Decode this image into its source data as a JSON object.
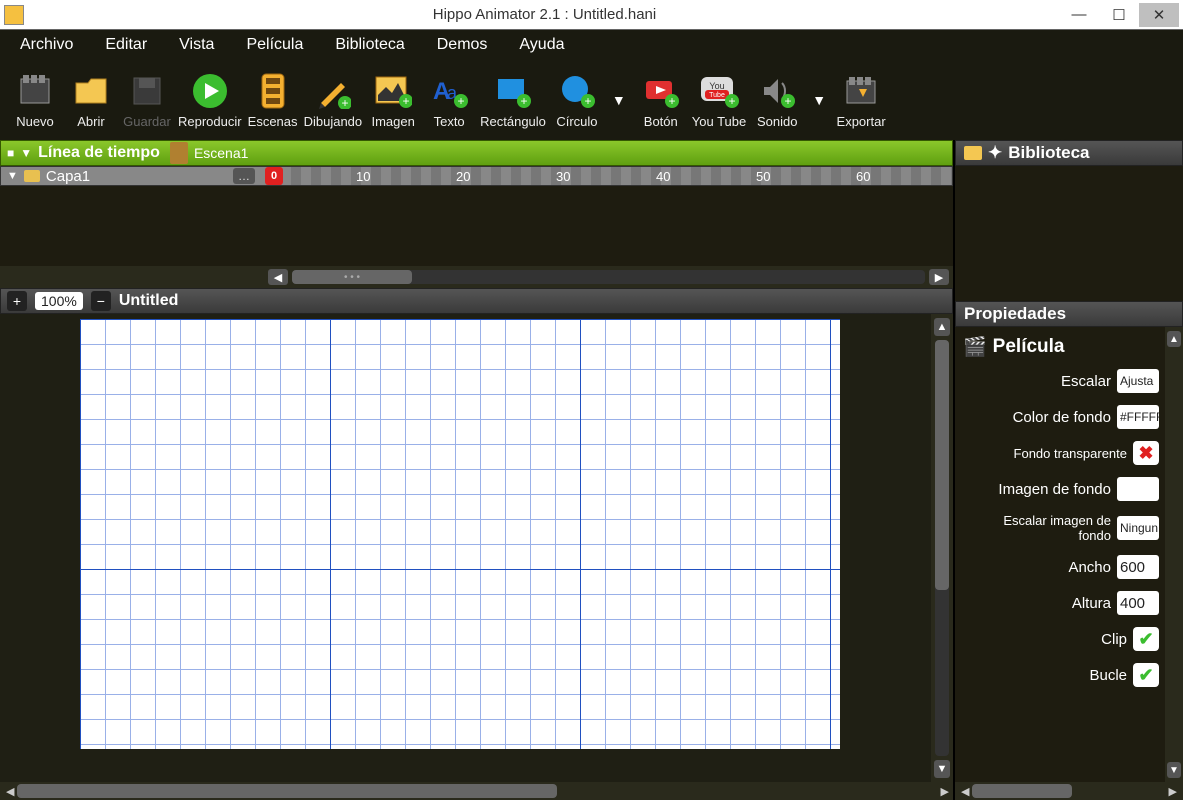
{
  "window": {
    "title": "Hippo Animator 2.1 : Untitled.hani"
  },
  "menu": {
    "items": [
      "Archivo",
      "Editar",
      "Vista",
      "Película",
      "Biblioteca",
      "Demos",
      "Ayuda"
    ]
  },
  "toolbar": {
    "items": [
      {
        "key": "nuevo",
        "label": "Nuevo"
      },
      {
        "key": "abrir",
        "label": "Abrir"
      },
      {
        "key": "guardar",
        "label": "Guardar",
        "disabled": true
      },
      {
        "key": "reproducir",
        "label": "Reproducir"
      },
      {
        "key": "escenas",
        "label": "Escenas"
      },
      {
        "key": "dibujando",
        "label": "Dibujando"
      },
      {
        "key": "imagen",
        "label": "Imagen"
      },
      {
        "key": "texto",
        "label": "Texto"
      },
      {
        "key": "rectangulo",
        "label": "Rectángulo"
      },
      {
        "key": "circulo",
        "label": "Círculo"
      },
      {
        "key": "boton",
        "label": "Botón"
      },
      {
        "key": "youtube",
        "label": "You Tube"
      },
      {
        "key": "sonido",
        "label": "Sonido"
      },
      {
        "key": "exportar",
        "label": "Exportar"
      }
    ]
  },
  "timeline": {
    "title": "Línea de tiempo",
    "scene": "Escena1",
    "layer": "Capa1",
    "playhead": "0",
    "ticks": [
      "10",
      "20",
      "30",
      "40",
      "50",
      "60"
    ]
  },
  "canvas": {
    "zoom": "100%",
    "title": "Untitled"
  },
  "library": {
    "title": "Biblioteca"
  },
  "properties": {
    "title": "Propiedades",
    "section": "Película",
    "rows": {
      "escalar_label": "Escalar",
      "escalar_val": "Ajusta",
      "bgcolor_label": "Color de fondo",
      "bgcolor_val": "#FFFFF",
      "transparent_label": "Fondo transparente",
      "bgimage_label": "Imagen de fondo",
      "bgimage_val": "",
      "bgscale_label": "Escalar imagen de fondo",
      "bgscale_val": "Ningun",
      "width_label": "Ancho",
      "width_val": "600",
      "height_label": "Altura",
      "height_val": "400",
      "clip_label": "Clip",
      "loop_label": "Bucle"
    }
  }
}
